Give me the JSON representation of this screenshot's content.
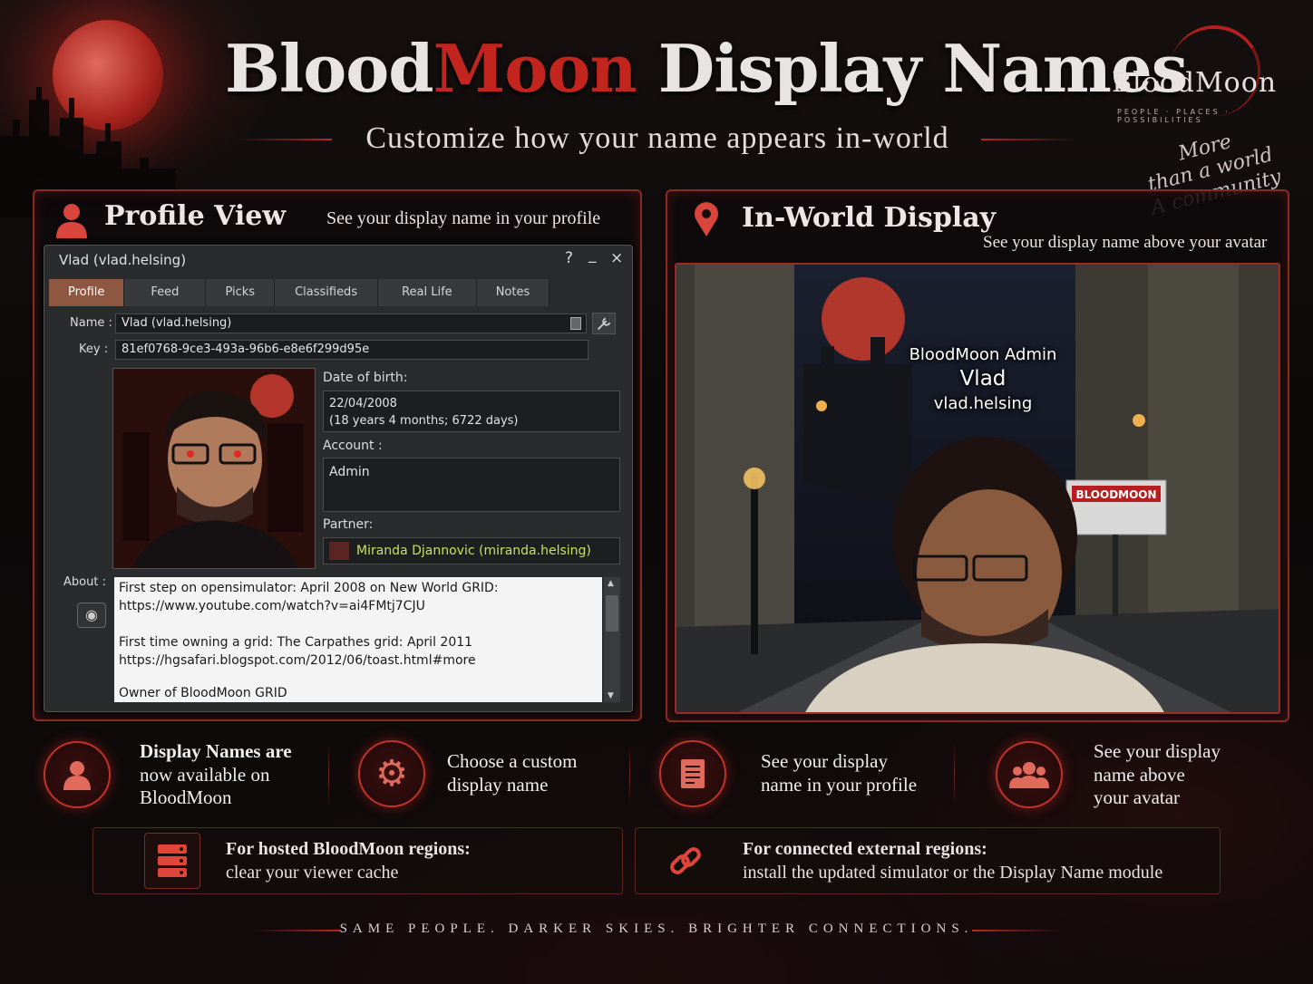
{
  "header": {
    "title_part1": "Blood",
    "title_part2": "Moon",
    "title_part3": " Display Names",
    "subtitle": "Customize how your name appears in-world"
  },
  "brand": {
    "logo": "BloodMoon",
    "tagline": "PEOPLE · PLACES · POSSIBILITIES",
    "motto_line1": "More",
    "motto_line2": "than a world",
    "motto_line3": "A community",
    "accent_color": "#c2241e"
  },
  "profile_panel": {
    "heading": "Profile View",
    "description": "See your display name in your profile",
    "icon": "person-icon"
  },
  "profile_window": {
    "title": "Vlad (vlad.helsing)",
    "controls": [
      "?",
      "_",
      "×"
    ],
    "tabs": [
      "Profile",
      "Feed",
      "Picks",
      "Classifieds",
      "Real Life",
      "Notes"
    ],
    "active_tab": "Profile",
    "name_label": "Name :",
    "name_value": "Vlad (vlad.helsing)",
    "key_label": "Key :",
    "key_value": "81ef0768-9ce3-493a-96b6-e8e6f299d95e",
    "dob_label": "Date of birth:",
    "dob_value": "22/04/2008",
    "dob_age": "(18 years 4 months; 6722 days)",
    "account_label": "Account :",
    "account_value": "Admin",
    "partner_label": "Partner:",
    "partner_value": "Miranda Djannovic (miranda.helsing)",
    "about_label": "About :",
    "about_lines": [
      "First step on opensimulator: April 2008 on New World GRID:",
      "https://www.youtube.com/watch?v=ai4FMtj7CJU",
      "",
      "First time owning a grid: The Carpathes grid: April 2011",
      "https://hgsafari.blogspot.com/2012/06/toast.html#more",
      "",
      "Owner of BloodMoon GRID"
    ]
  },
  "world_panel": {
    "heading": "In-World Display",
    "description": "See your display name above your avatar",
    "icon": "map-pin-icon",
    "tag_group": "BloodMoon Admin",
    "tag_display_name": "Vlad",
    "tag_username": "vlad.helsing",
    "sign_text": "BLOODMOON"
  },
  "features": [
    {
      "icon": "person-icon",
      "lines": [
        "Display Names are",
        "now available on",
        "BloodMoon"
      ]
    },
    {
      "icon": "gear-icon",
      "lines": [
        "Choose a custom",
        "display name"
      ]
    },
    {
      "icon": "document-icon",
      "lines": [
        "See your display",
        "name in your profile"
      ]
    },
    {
      "icon": "group-icon",
      "lines": [
        "See your display",
        "name above",
        "your avatar"
      ]
    }
  ],
  "info_boxes": [
    {
      "icon": "server-icon",
      "title": "For hosted BloodMoon regions:",
      "detail": "clear your viewer cache"
    },
    {
      "icon": "link-icon",
      "title": "For connected external regions:",
      "detail": "install the updated simulator or the Display Name module"
    }
  ],
  "footer": "SAME PEOPLE. DARKER SKIES. BRIGHTER CONNECTIONS."
}
